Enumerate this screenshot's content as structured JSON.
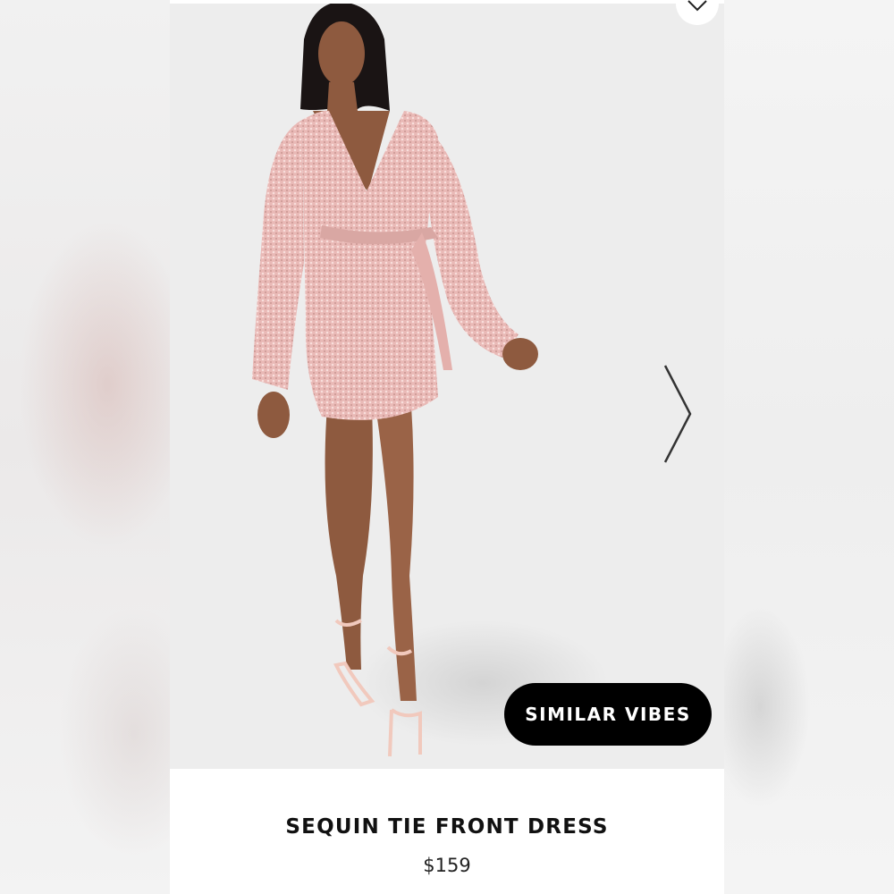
{
  "product": {
    "title": "SEQUIN TIE FRONT DRESS",
    "price": "$159",
    "image_alt": "Model wearing a pink sequin long-sleeve wrap mini dress with tie front and nude strappy heels"
  },
  "actions": {
    "similar_label": "SIMILAR VIBES"
  },
  "icons": {
    "wishlist": "chevron-down-icon",
    "next": "chevron-right-icon"
  },
  "colors": {
    "button_bg": "#000000",
    "button_text": "#ffffff",
    "dress": "#e9b9b6",
    "image_bg": "#ededed"
  }
}
